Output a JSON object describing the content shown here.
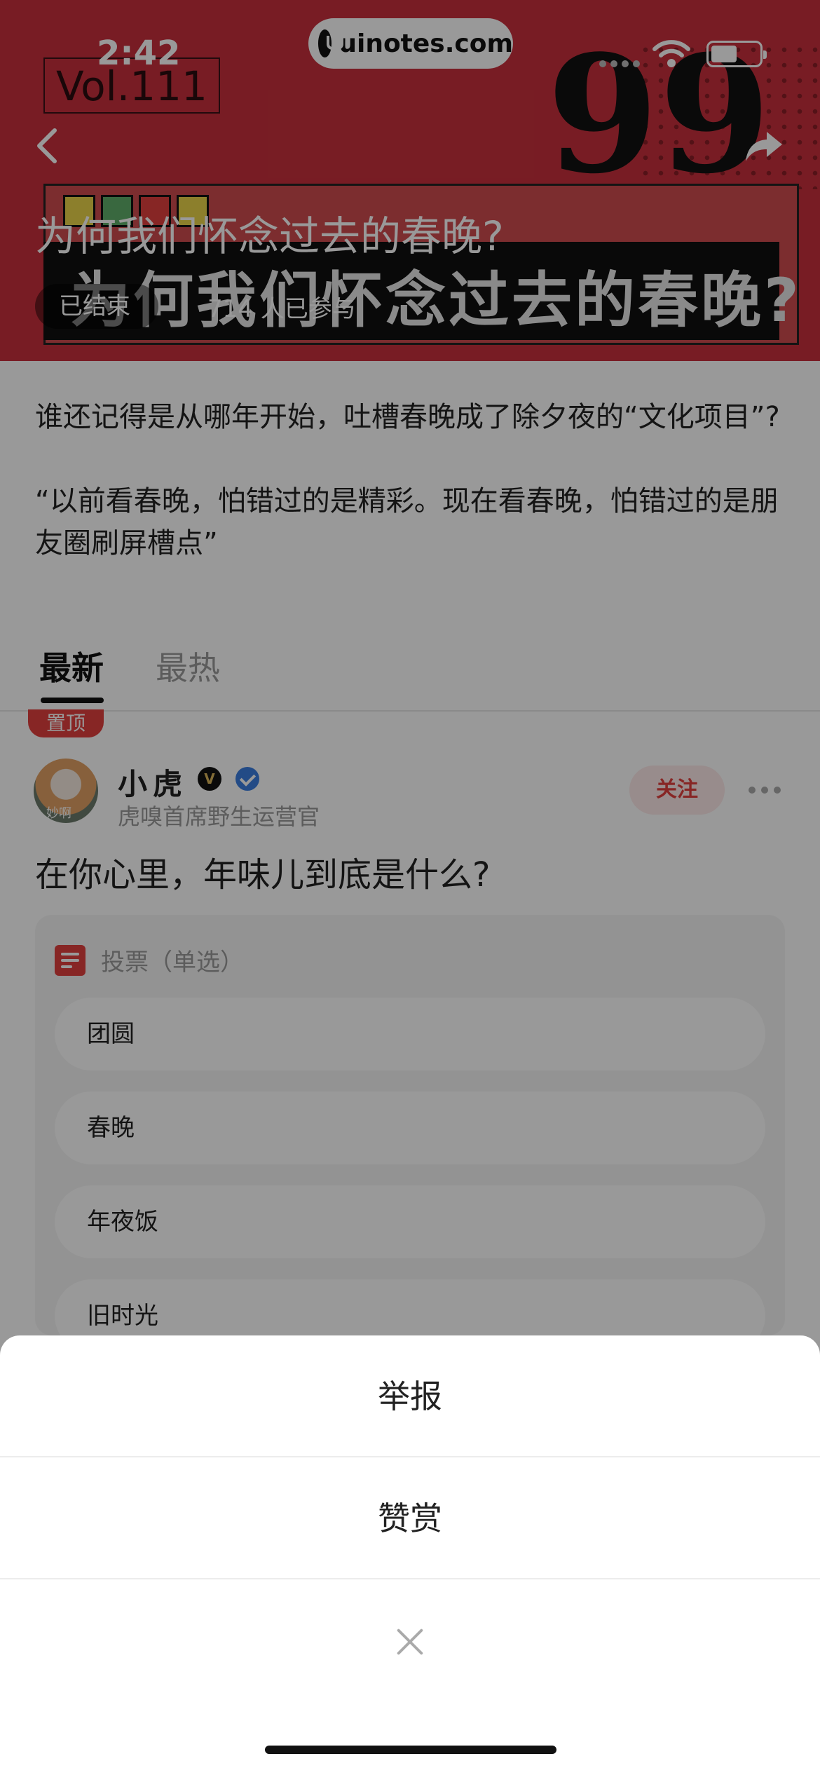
{
  "status_bar": {
    "time": "2:42",
    "url": "uinotes.com"
  },
  "hero": {
    "vol": "Vol.111",
    "title": "为何我们怀念过去的春晚?",
    "poster_text": "为何我们怀念过去的春晚?",
    "status": "已结束",
    "participants": "714 人已参与",
    "colors": {
      "background": "#c8303c"
    }
  },
  "intro": {
    "paragraphs": [
      "谁还记得是从哪年开始，吐槽春晚成了除夕夜的“文化项目”?",
      "“以前看春晚，怕错过的是精彩。现在看春晚，怕错过的是朋友圈刷屏槽点”"
    ]
  },
  "tabs": [
    {
      "label": "最新",
      "active": true
    },
    {
      "label": "最热",
      "active": false
    }
  ],
  "post": {
    "pinned_label": "置顶",
    "author": {
      "name": "小虎",
      "avatar_caption": "妙啊",
      "title": "虎嗅首席野生运营官",
      "badges": [
        "v-badge-icon",
        "verified-check-icon"
      ]
    },
    "follow_label": "关注",
    "question": "在你心里，年味儿到底是什么?",
    "vote": {
      "label": "投票（单选）",
      "options": [
        "团圆",
        "春晚",
        "年夜饭",
        "旧时光"
      ]
    }
  },
  "action_sheet": {
    "items": [
      {
        "label": "举报"
      },
      {
        "label": "赞赏"
      }
    ],
    "close_icon": "close-icon"
  },
  "colors": {
    "accent": "#e2403f",
    "verified": "#3b7de0"
  }
}
